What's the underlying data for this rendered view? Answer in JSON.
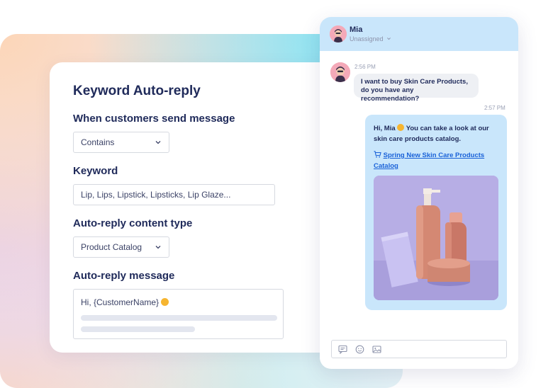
{
  "card": {
    "title": "Keyword Auto-reply",
    "trigger_label": "When customers send message",
    "trigger_value": "Contains",
    "keyword_label": "Keyword",
    "keyword_value": "Lip, Lips, Lipstick, Lipsticks, Lip Glaze...",
    "content_type_label": "Auto-reply content type",
    "content_type_value": "Product Catalog",
    "message_label": "Auto-reply message",
    "message_value": "Hi, {CustomerName}"
  },
  "chat": {
    "contact_name": "Mia",
    "assignment": "Unassigned",
    "messages": [
      {
        "time": "2:56 PM",
        "text": "I want to buy Skin Care Products, do you have any recommendation?"
      },
      {
        "time": "2:57 PM",
        "text": "Hi, Mia",
        "text_after_emoji": "You can take a look at our skin care products catalog.",
        "link": "Spring New Skin Care Products Catalog"
      }
    ]
  },
  "icons": [
    "chevron-down-icon",
    "smile-emoji-icon",
    "cart-icon",
    "chat-template-icon",
    "emoji-icon",
    "image-icon"
  ],
  "colors": {
    "title_navy": "#1f2a5a",
    "chat_header_blue": "#c9e6fb",
    "link_blue": "#1a62d8",
    "emoji_yellow": "#f6b530",
    "product_bg_lavender": "#b7aee5"
  }
}
